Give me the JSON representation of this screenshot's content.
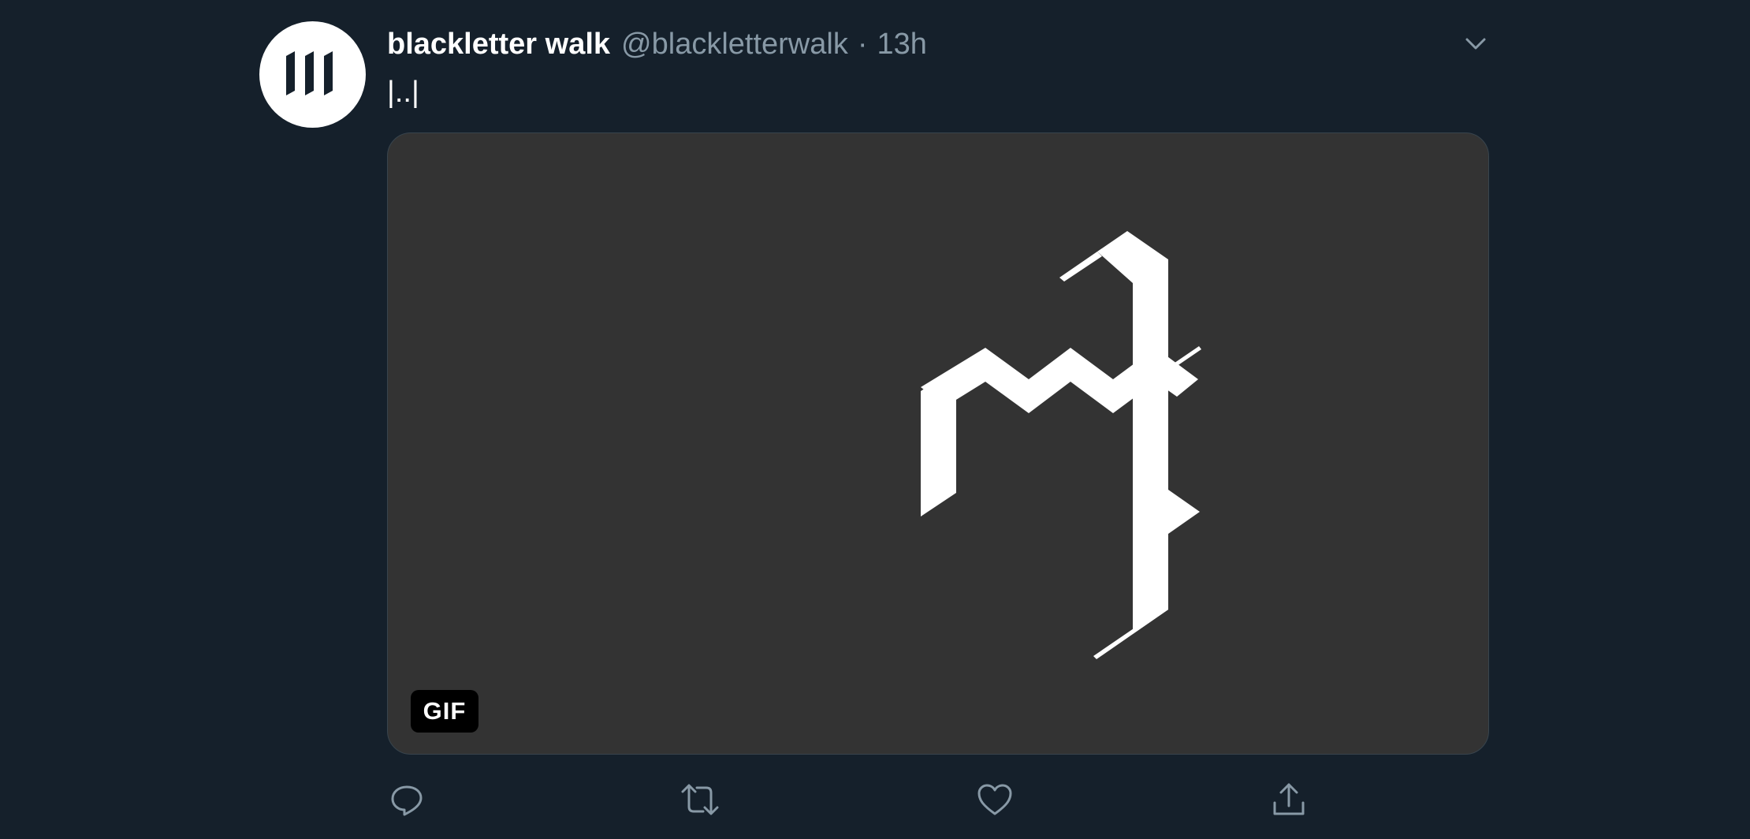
{
  "tweet": {
    "display_name": "blackletter walk",
    "handle": "@blackletterwalk",
    "separator": "·",
    "time": "13h",
    "text": "|..|",
    "media": {
      "badge": "GIF"
    },
    "icons": {
      "avatar": "blackletter-logo-icon",
      "more": "chevron-down-icon",
      "reply": "reply-icon",
      "retweet": "retweet-icon",
      "like": "heart-icon",
      "share": "share-icon"
    },
    "colors": {
      "background": "#15202b",
      "secondary_text": "#8899a6",
      "media_background": "#333333"
    }
  }
}
